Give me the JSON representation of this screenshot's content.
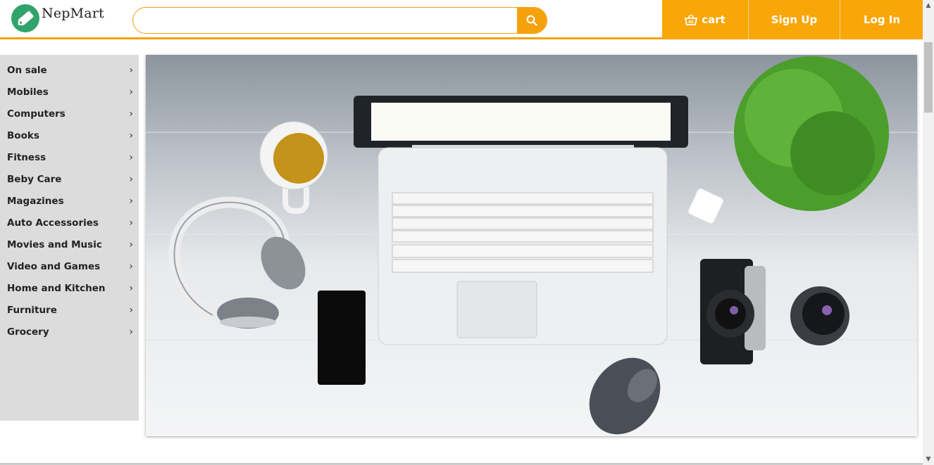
{
  "header": {
    "brand": "NepMart",
    "search": {
      "placeholder": "",
      "value": ""
    },
    "nav": {
      "cart": "cart",
      "signup": "Sign Up",
      "login": "Log In"
    }
  },
  "sidebar": {
    "items": [
      {
        "label": "On sale"
      },
      {
        "label": "Mobiles"
      },
      {
        "label": "Computers"
      },
      {
        "label": "Books"
      },
      {
        "label": "Fitness"
      },
      {
        "label": "Beby Care"
      },
      {
        "label": "Magazines"
      },
      {
        "label": "Auto Accessories"
      },
      {
        "label": "Movies and Music"
      },
      {
        "label": "Video and Games"
      },
      {
        "label": "Home and Kitchen"
      },
      {
        "label": "Furniture"
      },
      {
        "label": "Grocery"
      }
    ],
    "chevron": "›"
  },
  "hero": {
    "alt": "Laptop, headphones, coffee cup, phone, mouse, camera, lens and plant on a white desk"
  },
  "colors": {
    "accent": "#f9a608",
    "logo": "#2fa36b",
    "sidebar_bg": "#dcdcdc"
  },
  "icons": {
    "search": "search-icon",
    "cart": "basket-icon",
    "logo": "tag-icon",
    "chevron": "chevron-right-icon"
  }
}
